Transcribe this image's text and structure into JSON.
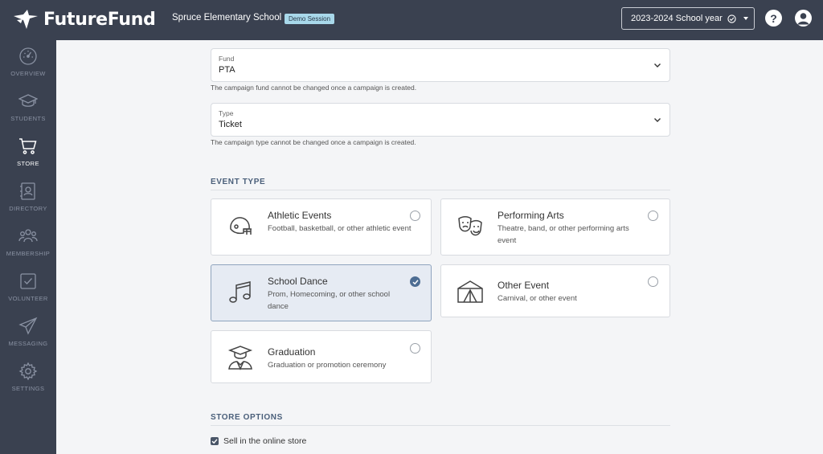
{
  "app": {
    "brand": "FutureFund",
    "school": "Spruce Elementary School",
    "badge": "Demo Session",
    "year": "2023-2024 School year",
    "help": "?"
  },
  "sidebar": {
    "items": [
      {
        "label": "OVERVIEW",
        "icon": "gauge-icon"
      },
      {
        "label": "STUDENTS",
        "icon": "graduation-cap-icon"
      },
      {
        "label": "STORE",
        "icon": "cart-icon",
        "active": true
      },
      {
        "label": "DIRECTORY",
        "icon": "contact-card-icon"
      },
      {
        "label": "MEMBERSHIP",
        "icon": "people-icon"
      },
      {
        "label": "VOLUNTEER",
        "icon": "checkbox-icon"
      },
      {
        "label": "MESSAGING",
        "icon": "paper-plane-icon"
      },
      {
        "label": "SETTINGS",
        "icon": "gear-icon"
      }
    ]
  },
  "form": {
    "fund": {
      "label": "Fund",
      "value": "PTA",
      "helper": "The campaign fund cannot be changed once a campaign is created."
    },
    "type": {
      "label": "Type",
      "value": "Ticket",
      "helper": "The campaign type cannot be changed once a campaign is created."
    }
  },
  "event_type": {
    "title": "EVENT TYPE",
    "options": [
      {
        "title": "Athletic Events",
        "desc": "Football, basketball, or other athletic event",
        "icon": "football-helmet-icon",
        "selected": false
      },
      {
        "title": "Performing Arts",
        "desc": "Theatre, band, or other performing arts event",
        "icon": "theater-masks-icon",
        "selected": false
      },
      {
        "title": "School Dance",
        "desc": "Prom, Homecoming, or other school dance",
        "icon": "music-note-icon",
        "selected": true
      },
      {
        "title": "Other Event",
        "desc": "Carnival, or other event",
        "icon": "tent-icon",
        "selected": false
      },
      {
        "title": "Graduation",
        "desc": "Graduation or promotion ceremony",
        "icon": "graduate-icon",
        "selected": false
      }
    ]
  },
  "store_options": {
    "title": "STORE OPTIONS",
    "online_store": {
      "label": "Sell in the online store",
      "checked": true
    }
  },
  "colors": {
    "topbar": "#3a4150",
    "accent": "#4d6d93",
    "selected_card": "#e6ebf3",
    "badge": "#a8d8ea"
  }
}
